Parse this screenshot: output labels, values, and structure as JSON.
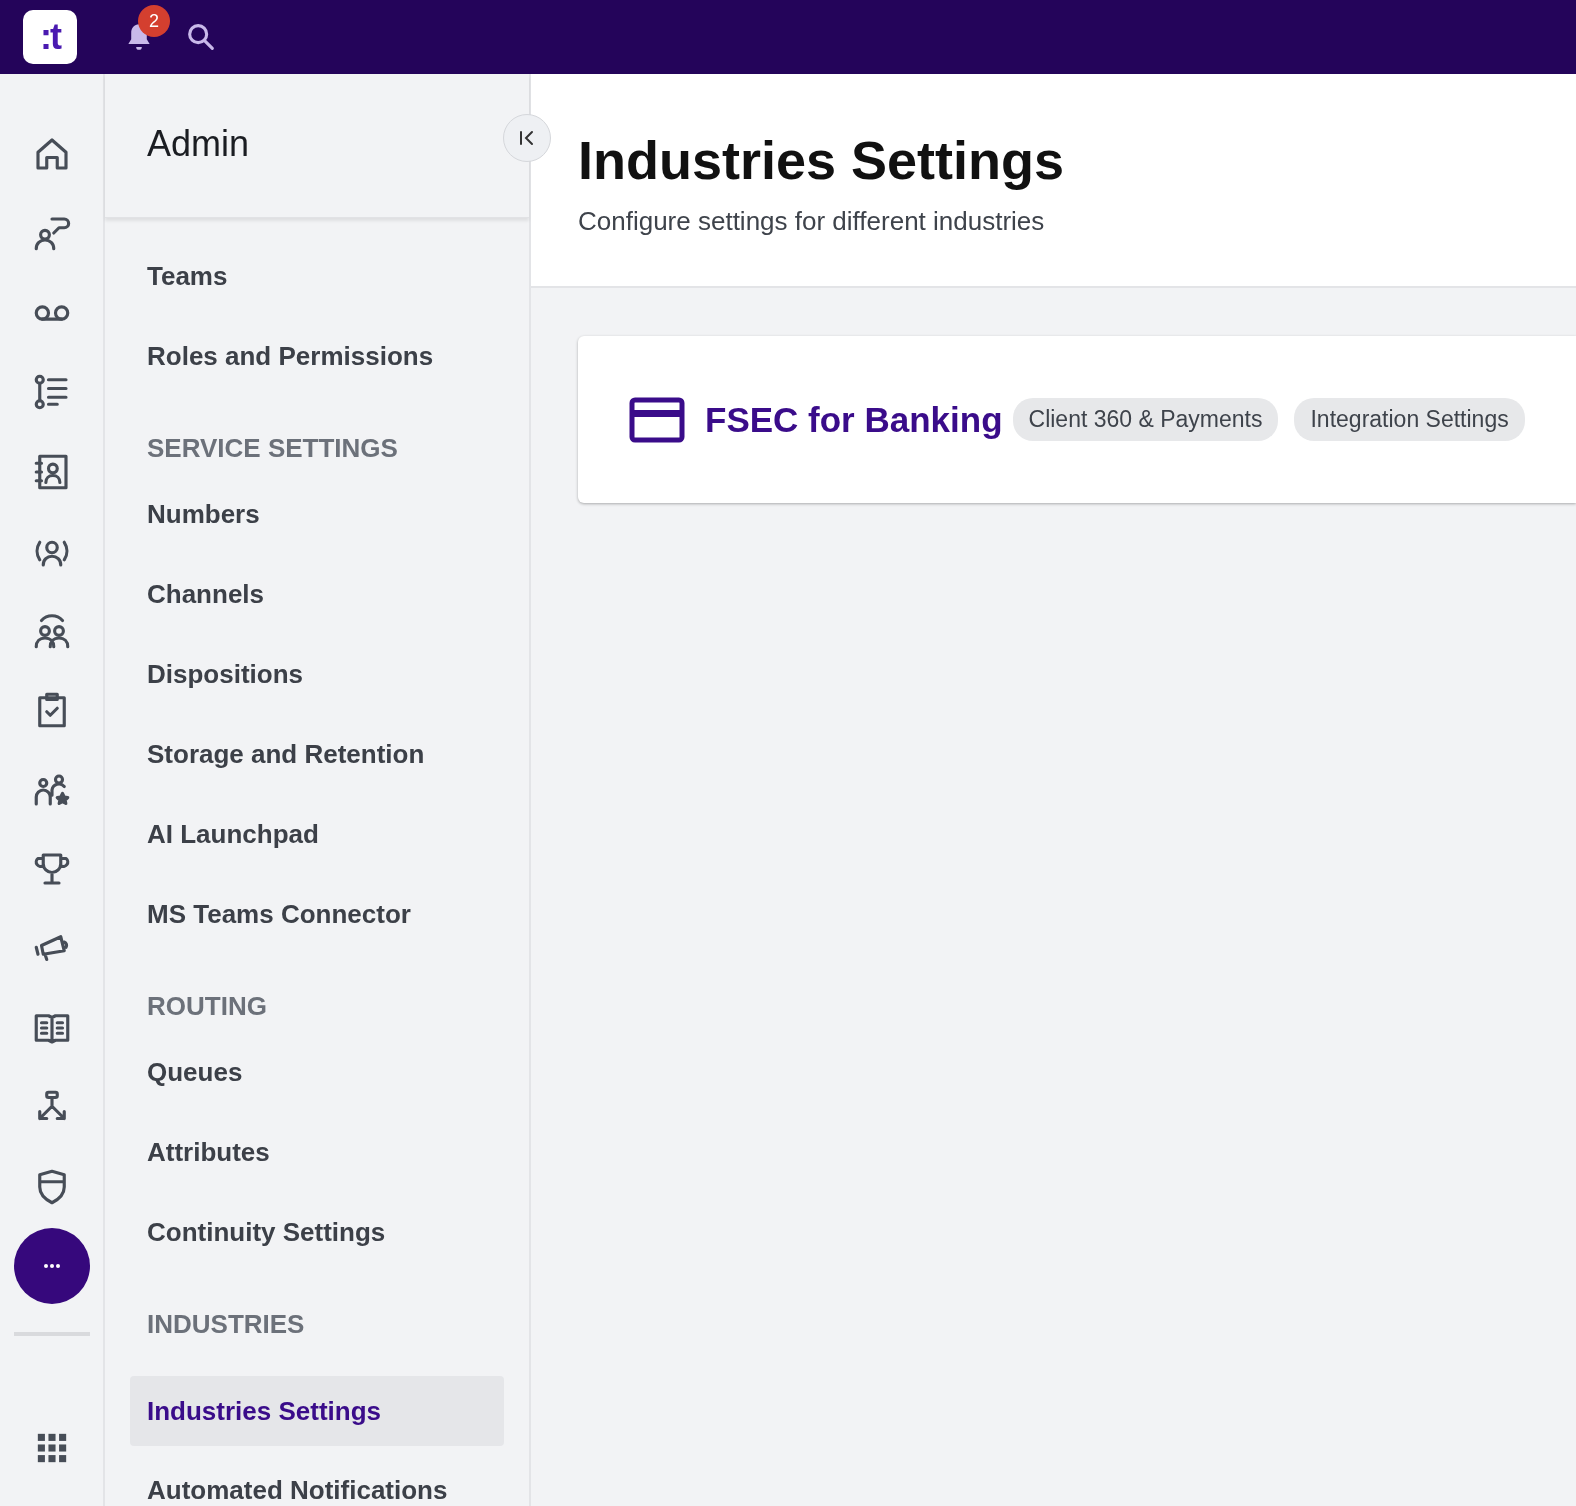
{
  "top_bar": {
    "logo": ":t",
    "notification_count": "2"
  },
  "sidebar": {
    "title": "Admin",
    "groups": [
      {
        "items": [
          {
            "label": "Teams",
            "selected": false
          },
          {
            "label": "Roles and Permissions",
            "selected": false
          }
        ]
      },
      {
        "heading": "SERVICE SETTINGS",
        "items": [
          {
            "label": "Numbers",
            "selected": false
          },
          {
            "label": "Channels",
            "selected": false
          },
          {
            "label": "Dispositions",
            "selected": false
          },
          {
            "label": "Storage and Retention",
            "selected": false
          },
          {
            "label": "AI Launchpad",
            "selected": false
          },
          {
            "label": "MS Teams Connector",
            "selected": false
          }
        ]
      },
      {
        "heading": "ROUTING",
        "items": [
          {
            "label": "Queues",
            "selected": false
          },
          {
            "label": "Attributes",
            "selected": false
          },
          {
            "label": "Continuity Settings",
            "selected": false
          }
        ]
      },
      {
        "heading": "INDUSTRIES",
        "items": [
          {
            "label": "Industries Settings",
            "selected": true
          },
          {
            "label": "Automated Notifications",
            "selected": false
          }
        ]
      }
    ]
  },
  "page": {
    "title": "Industries Settings",
    "subtitle": "Configure settings for different industries"
  },
  "cards": [
    {
      "title": "FSEC for Banking",
      "tags": [
        "Client 360 & Payments",
        "Integration Settings"
      ]
    }
  ]
}
